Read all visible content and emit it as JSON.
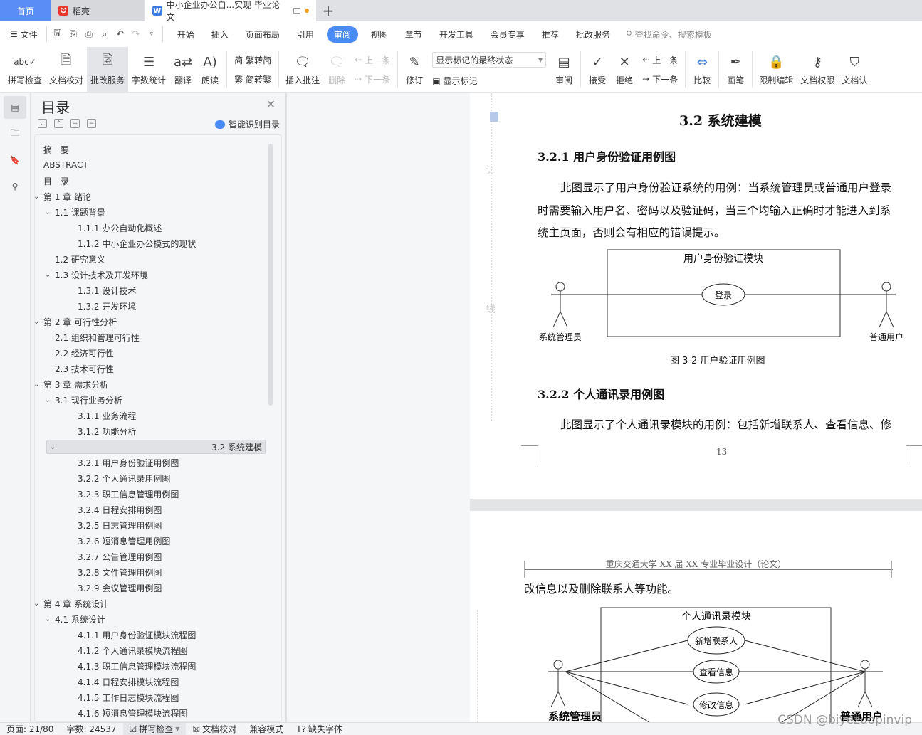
{
  "tabs": {
    "home": "首页",
    "daoke": "稻壳",
    "doc": "中小企业办公自...实现 毕业论文",
    "add": "+"
  },
  "menu": {
    "file": "文件",
    "items": [
      "开始",
      "插入",
      "页面布局",
      "引用",
      "审阅",
      "视图",
      "章节",
      "开发工具",
      "会员专享",
      "推荐",
      "批改服务"
    ],
    "active": "审阅",
    "search_placeholder": "查找命令、搜索模板"
  },
  "ribbon": {
    "spell": "拼写检查",
    "proofread": "文档校对",
    "review_service": "批改服务",
    "wordcount": "字数统计",
    "translate": "翻译",
    "read": "朗读",
    "trad_to_simp": "繁转简",
    "simp_to_trad": "简转繁",
    "insert_comment": "插入批注",
    "delete": "删除",
    "prev_comment": "上一条",
    "next_comment": "下一条",
    "track": "修订",
    "markup_state": "显示标记的最终状态",
    "show_markup": "显示标记",
    "review": "审阅",
    "accept": "接受",
    "reject": "拒绝",
    "prev_change": "上一条",
    "next_change": "下一条",
    "compare": "比较",
    "pen": "画笔",
    "restrict": "限制编辑",
    "permission": "文档权限",
    "auth": "文档认"
  },
  "toc": {
    "title": "目录",
    "smart": "智能识别目录",
    "items": [
      {
        "label": "摘　要",
        "level": 0,
        "chev": false
      },
      {
        "label": "ABSTRACT",
        "level": 0,
        "chev": false
      },
      {
        "label": "目　录",
        "level": 0,
        "chev": false
      },
      {
        "label": "第 1 章  绪论",
        "level": 0,
        "chev": true
      },
      {
        "label": "1.1  课题背景",
        "level": 1,
        "chev": true
      },
      {
        "label": "1.1.1  办公自动化概述",
        "level": 2,
        "chev": false
      },
      {
        "label": "1.1.2  中小企业办公模式的现状",
        "level": 2,
        "chev": false
      },
      {
        "label": "1.2  研究意义",
        "level": 1,
        "chev": false
      },
      {
        "label": "1.3  设计技术及开发环境",
        "level": 1,
        "chev": true
      },
      {
        "label": "1.3.1  设计技术",
        "level": 2,
        "chev": false
      },
      {
        "label": "1.3.2  开发环境",
        "level": 2,
        "chev": false
      },
      {
        "label": "第 2 章  可行性分析",
        "level": 0,
        "chev": true
      },
      {
        "label": "2.1  组织和管理可行性",
        "level": 1,
        "chev": false
      },
      {
        "label": "2.2  经济可行性",
        "level": 1,
        "chev": false
      },
      {
        "label": "2.3  技术可行性",
        "level": 1,
        "chev": false
      },
      {
        "label": "第 3 章  需求分析",
        "level": 0,
        "chev": true
      },
      {
        "label": "3.1  现行业务分析",
        "level": 1,
        "chev": true
      },
      {
        "label": "3.1.1  业务流程",
        "level": 2,
        "chev": false
      },
      {
        "label": "3.1.2  功能分析",
        "level": 2,
        "chev": false
      },
      {
        "label": "3.2  系统建模",
        "level": 1,
        "chev": true,
        "selected": true
      },
      {
        "label": "3.2.1  用户身份验证用例图",
        "level": 2,
        "chev": false
      },
      {
        "label": "3.2.2  个人通讯录用例图",
        "level": 2,
        "chev": false
      },
      {
        "label": "3.2.3  职工信息管理用例图",
        "level": 2,
        "chev": false
      },
      {
        "label": "3.2.4  日程安排用例图",
        "level": 2,
        "chev": false
      },
      {
        "label": "3.2.5  日志管理用例图",
        "level": 2,
        "chev": false
      },
      {
        "label": "3.2.6  短消息管理用例图",
        "level": 2,
        "chev": false
      },
      {
        "label": "3.2.7  公告管理用例图",
        "level": 2,
        "chev": false
      },
      {
        "label": "3.2.8  文件管理用例图",
        "level": 2,
        "chev": false
      },
      {
        "label": "3.2.9  会议管理用例图",
        "level": 2,
        "chev": false
      },
      {
        "label": "第 4 章  系统设计",
        "level": 0,
        "chev": true
      },
      {
        "label": "4.1  系统设计",
        "level": 1,
        "chev": true
      },
      {
        "label": "4.1.1  用户身份验证模块流程图",
        "level": 2,
        "chev": false
      },
      {
        "label": "4.1.2  个人通讯录模块流程图",
        "level": 2,
        "chev": false
      },
      {
        "label": "4.1.3  职工信息管理模块流程图",
        "level": 2,
        "chev": false
      },
      {
        "label": "4.1.4  日程安排模块流程图",
        "level": 2,
        "chev": false
      },
      {
        "label": "4.1.5  工作日志模块流程图",
        "level": 2,
        "chev": false
      },
      {
        "label": "4.1.6  短消息管理模块流程图",
        "level": 2,
        "chev": false
      }
    ]
  },
  "page1": {
    "heading": "3.2  系统建模",
    "sub1": "3.2.1  用户身份验证用例图",
    "para1": [
      "此图显示了用户身份验证系统的用例：当系统管理员或普通用户登录",
      "时需要输入用户名、密码以及验证码，当三个均输入正确时才能进入到系",
      "统主页面，否则会有相应的错误提示。"
    ],
    "diagram1": {
      "module": "用户身份验证模块",
      "usecase": "登录",
      "actor_left": "系统管理员",
      "actor_right": "普通用户"
    },
    "caption1": "图  3-2  用户验证用例图",
    "sub2": "3.2.2  个人通讯录用例图",
    "para2": "此图显示了个人通讯录模块的用例：包括新增联系人、查看信息、修",
    "page_number": "13",
    "binding_marks": [
      "订",
      "线"
    ]
  },
  "page2": {
    "header": "重庆交通大学 XX 届 XX 专业毕业设计（论文）",
    "para": "改信息以及删除联系人等功能。",
    "diagram2": {
      "module": "个人通讯录模块",
      "usecases": [
        "新增联系人",
        "查看信息",
        "修改信息"
      ],
      "actor_left": "系统管理员",
      "actor_right": "普通用户"
    }
  },
  "status": {
    "page": "页面: 21/80",
    "words": "字数: 24537",
    "spell": "拼写检查",
    "proofread": "文档校对",
    "compat": "兼容模式",
    "missing_font": "缺失字体"
  },
  "watermark": "CSDN @biyezuopinvip"
}
